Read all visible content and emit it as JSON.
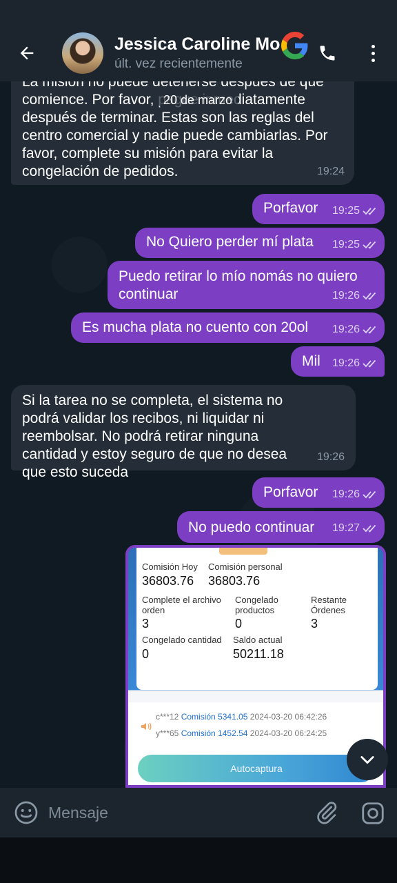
{
  "header": {
    "contact_name": "Jessica Caroline Mo",
    "status": "últ. vez recientemente"
  },
  "date_chip": "20 de marzo",
  "messages": [
    {
      "dir": "in",
      "text": "La misión no puede detenerse después de que comience. Por favor, pague inmediatamente después de terminar. Estas son las reglas del centro comercial y nadie puede cambiarlas. Por favor, complete su misión para evitar la congelación de pedidos.",
      "time": "19:24"
    },
    {
      "dir": "out",
      "text": "Porfavor",
      "time": "19:25"
    },
    {
      "dir": "out",
      "text": "No Quiero perder mí plata",
      "time": "19:25"
    },
    {
      "dir": "out",
      "text": "Puedo retirar lo mío nomás no quiero continuar",
      "time": "19:26"
    },
    {
      "dir": "out",
      "text": "Es mucha plata no cuento con 20ol",
      "time": "19:26"
    },
    {
      "dir": "out",
      "text": "Mil",
      "time": "19:26"
    },
    {
      "dir": "in",
      "text": "Si la tarea no se completa, el sistema no podrá validar los recibos, ni liquidar ni reembolsar. No podrá retirar ninguna cantidad y estoy seguro de que no desea que esto suceda",
      "time": "19:26"
    },
    {
      "dir": "out",
      "text": "Porfavor",
      "time": "19:26"
    },
    {
      "dir": "out",
      "text": "No puedo continuar",
      "time": "19:27"
    }
  ],
  "screenshot": {
    "comision_hoy_label": "Comisión Hoy",
    "comision_hoy_value": "36803.76",
    "comision_personal_label": "Comisión personal",
    "comision_personal_value": "36803.76",
    "complete_label": "Complete el archivo orden",
    "complete_value": "3",
    "congelado_prod_label": "Congelado productos",
    "congelado_prod_value": "0",
    "restante_label": "Restante Órdenes",
    "restante_value": "3",
    "congelado_cant_label": "Congelado cantidad",
    "congelado_cant_value": "0",
    "saldo_label": "Saldo actual",
    "saldo_value": "50211.18",
    "log": [
      {
        "user": "c***12",
        "label": "Comisión",
        "amount": "5341.05",
        "datetime": "2024-03-20 06:42:26"
      },
      {
        "user": "y***65",
        "label": "Comisión",
        "amount": "1452.54",
        "datetime": "2024-03-20 06:24:25"
      }
    ],
    "button_label": "Autocaptura"
  },
  "composer": {
    "placeholder": "Mensaje"
  },
  "colors": {
    "outgoing_bubble": "#7c3fc4",
    "incoming_bubble": "#252e38",
    "header": "#1c252e"
  },
  "icons": [
    "back-arrow-icon",
    "google-icon",
    "phone-icon",
    "more-vert-icon",
    "double-check-icon",
    "chevron-down-icon",
    "emoji-icon",
    "paperclip-icon",
    "camera-icon",
    "speaker-icon"
  ]
}
